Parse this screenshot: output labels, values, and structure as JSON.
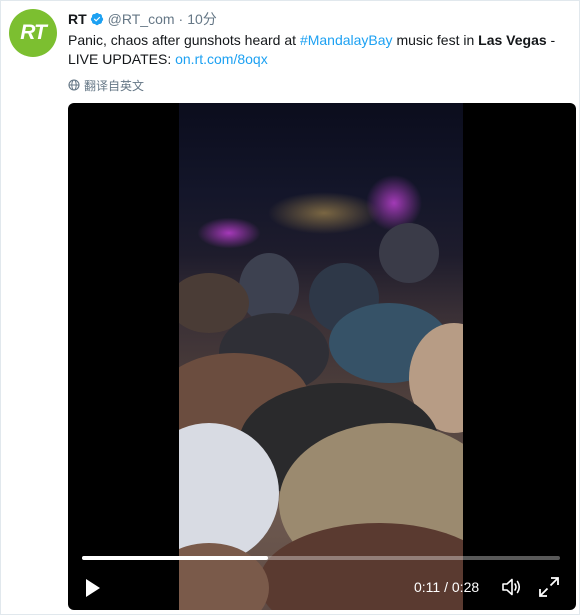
{
  "tweet": {
    "avatar_text": "RT",
    "name": "RT",
    "handle": "@RT_com",
    "separator": "·",
    "time": "10分",
    "text_1": "Panic, chaos after gunshots heard at ",
    "hashtag": "#MandalayBay",
    "text_2": " music fest in ",
    "location": "Las Vegas",
    "text_3": " - LIVE UPDATES: ",
    "link": "on.rt.com/8oqx",
    "translate_label": "翻译自英文"
  },
  "video": {
    "current_time": "0:11",
    "time_separator": " / ",
    "duration": "0:28",
    "progress": 0.39
  },
  "colors": {
    "link": "#1da1f2",
    "avatar": "#7cbf30",
    "muted": "#657786"
  },
  "icons": [
    "verified-icon",
    "globe-icon",
    "play-icon",
    "volume-icon",
    "fullscreen-icon"
  ]
}
